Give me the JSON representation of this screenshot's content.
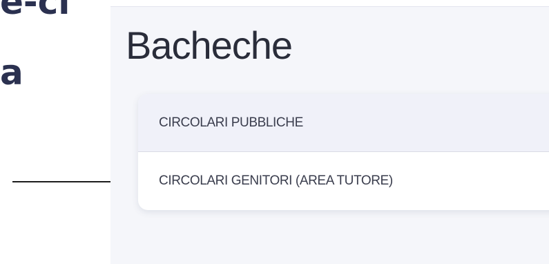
{
  "background": {
    "partial_text_top": "e-ci",
    "partial_text_a": "a"
  },
  "panel": {
    "title": "Bacheche"
  },
  "bacheche_list": {
    "items": [
      {
        "label": "CIRCOLARI PUBBLICHE"
      },
      {
        "label": "CIRCOLARI GENITORI (AREA TUTORE)"
      }
    ]
  },
  "annotation": {
    "arrow_icon": "arrow-right-icon",
    "points_to": "CIRCOLARI GENITORI (AREA TUTORE)"
  },
  "colors": {
    "panel_bg": "#f5f6fa",
    "card_bg": "#ffffff",
    "highlight_row": "#f0f1f9",
    "text_dark": "#2a2d3a"
  }
}
